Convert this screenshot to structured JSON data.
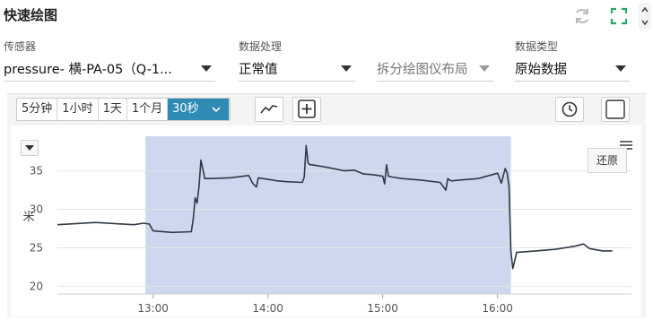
{
  "header": {
    "title": "快速绘图",
    "refresh_icon": "refresh-icon",
    "expand_icon": "fullscreen-icon",
    "accent": "#2ca66a"
  },
  "filters": [
    {
      "label": "传感器",
      "value": "pressure- 横-PA-05（Q-1...",
      "disabled": false
    },
    {
      "label": "数据处理",
      "value": "正常值",
      "disabled": false
    },
    {
      "label": "",
      "value": "拆分绘图仪布局",
      "disabled": true
    },
    {
      "label": "数据类型",
      "value": "原始数据",
      "disabled": false
    }
  ],
  "toolbar": {
    "ranges": [
      "5分钟",
      "1小时",
      "1天",
      "1个月"
    ],
    "selected_range": "30秒",
    "active_color": "#2f8ab4",
    "line_icon": "line-chart-icon",
    "add_icon": "add-box-icon",
    "clock_icon": "clock-icon",
    "square_icon": "square-icon"
  },
  "chart_data": {
    "type": "line",
    "title": "",
    "xlabel": "",
    "ylabel": "米",
    "ylim": [
      19,
      39.5
    ],
    "xlim": [
      "12:10",
      "17:10"
    ],
    "x_ticks": [
      "13:00",
      "14:00",
      "15:00",
      "16:00"
    ],
    "y_ticks": [
      20,
      25,
      30,
      35
    ],
    "grid": true,
    "line_color": "#2f3a45",
    "highlight": {
      "from": "12:56",
      "to": "16:07",
      "color": "#cdd8ef"
    },
    "tooltip": "还原",
    "series": [
      {
        "x": [
          "12:10",
          "12:30",
          "12:50",
          "12:55",
          "12:58",
          "13:00",
          "13:10",
          "13:20",
          "13:21",
          "13:22",
          "13:23",
          "13:24",
          "13:25",
          "13:27",
          "13:30",
          "13:40",
          "13:50",
          "13:52",
          "13:54",
          "13:55",
          "14:00",
          "14:05",
          "14:10",
          "14:18",
          "14:19",
          "14:20",
          "14:21",
          "14:22",
          "14:23",
          "14:30",
          "14:40",
          "14:45",
          "14:50",
          "14:55",
          "15:00",
          "15:01",
          "15:02",
          "15:03",
          "15:05",
          "15:10",
          "15:20",
          "15:30",
          "15:33",
          "15:34",
          "15:35",
          "15:36",
          "15:40",
          "15:50",
          "16:00",
          "16:02",
          "16:04",
          "16:05",
          "16:06",
          "16:07",
          "16:08",
          "16:10",
          "16:20",
          "16:30",
          "16:40",
          "16:45",
          "16:48",
          "16:55",
          "17:00"
        ],
        "y": [
          28.0,
          28.3,
          28.0,
          28.2,
          28.1,
          27.2,
          27.0,
          27.1,
          28.8,
          31.5,
          30.8,
          33.0,
          36.4,
          34.0,
          34.0,
          34.1,
          34.4,
          33.4,
          32.9,
          34.1,
          33.9,
          33.7,
          33.6,
          33.5,
          34.2,
          38.3,
          36.0,
          35.8,
          35.8,
          35.5,
          35.0,
          35.1,
          34.6,
          34.5,
          34.3,
          33.3,
          35.8,
          34.3,
          34.2,
          34.0,
          33.8,
          33.5,
          32.5,
          34.0,
          33.8,
          33.7,
          33.8,
          34.0,
          34.7,
          33.4,
          35.3,
          34.8,
          33.0,
          24.5,
          22.3,
          24.4,
          24.6,
          24.8,
          25.2,
          25.5,
          24.9,
          24.6,
          24.6
        ]
      }
    ]
  }
}
